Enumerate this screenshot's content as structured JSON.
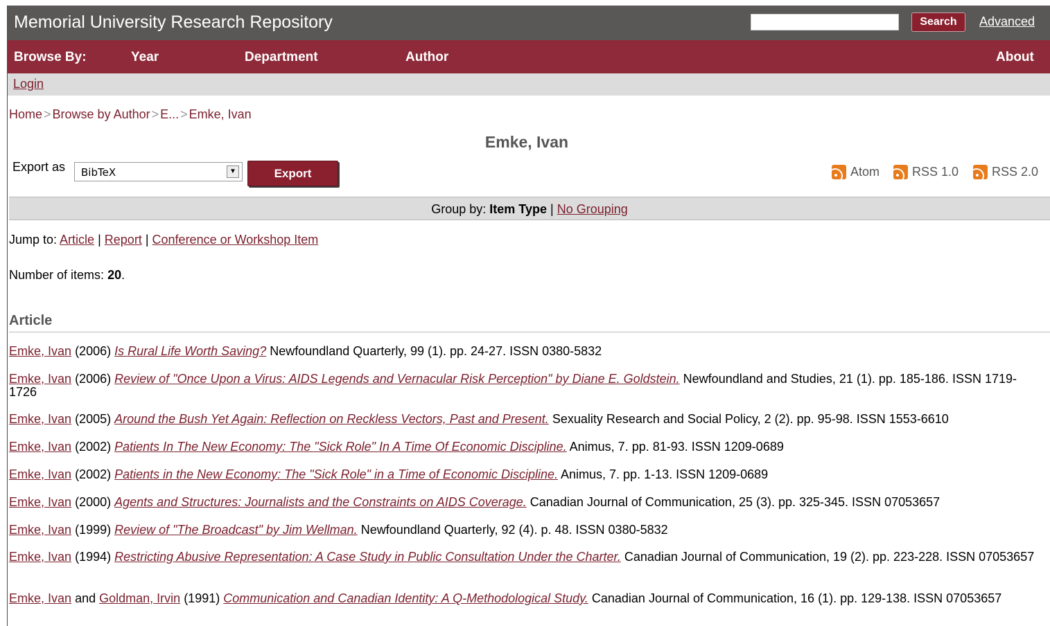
{
  "header": {
    "site_title": "Memorial University Research Repository",
    "search_value": "",
    "search_button": "Search",
    "advanced_link": "Advanced"
  },
  "nav": {
    "browse_by": "Browse By:",
    "year": "Year",
    "department": "Department",
    "author": "Author",
    "about": "About"
  },
  "login": "Login",
  "breadcrumb": [
    "Home",
    "Browse by Author",
    "E...",
    "Emke, Ivan"
  ],
  "breadcrumb_sep": ">",
  "page_title": "Emke, Ivan",
  "export": {
    "label": "Export as",
    "selected": "BibTeX",
    "button": "Export"
  },
  "feeds": [
    "Atom",
    "RSS 1.0",
    "RSS 2.0"
  ],
  "group_by": {
    "label": "Group by:",
    "current": "Item Type",
    "sep": "|",
    "alternative": "No Grouping"
  },
  "jump_to": {
    "label": "Jump to:",
    "links": [
      "Article",
      "Report",
      "Conference or Workshop Item"
    ],
    "sep": "|"
  },
  "item_count": {
    "label": "Number of items:",
    "value": "20",
    "suffix": "."
  },
  "section": "Article",
  "entries": [
    {
      "authors": [
        "Emke, Ivan"
      ],
      "year": "(2006)",
      "title": "Is Rural Life Worth Saving?",
      "rest": "Newfoundland Quarterly, 99 (1). pp. 24-27. ISSN 0380-5832"
    },
    {
      "authors": [
        "Emke, Ivan"
      ],
      "year": "(2006)",
      "title": "Review of \"Once Upon a Virus: AIDS Legends and Vernacular Risk Perception\" by Diane E. Goldstein.",
      "rest": "Newfoundland and Studies, 21 (1). pp. 185-186. ISSN 1719-1726"
    },
    {
      "authors": [
        "Emke, Ivan"
      ],
      "year": "(2005)",
      "title": "Around the Bush Yet Again: Reflection on Reckless Vectors, Past and Present.",
      "rest": "Sexuality Research and Social Policy, 2 (2). pp. 95-98. ISSN 1553-6610"
    },
    {
      "authors": [
        "Emke, Ivan"
      ],
      "year": "(2002)",
      "title": "Patients In The New Economy: The \"Sick Role\" In A Time Of Economic Discipline.",
      "rest": "Animus, 7. pp. 81-93. ISSN 1209-0689"
    },
    {
      "authors": [
        "Emke, Ivan"
      ],
      "year": "(2002)",
      "title": "Patients in the New Economy: The \"Sick Role\" in a Time of Economic Discipline.",
      "rest": "Animus, 7. pp. 1-13. ISSN 1209-0689"
    },
    {
      "authors": [
        "Emke, Ivan"
      ],
      "year": "(2000)",
      "title": "Agents and Structures: Journalists and the Constraints on AIDS Coverage.",
      "rest": "Canadian Journal of Communication, 25 (3). pp. 325-345. ISSN 07053657"
    },
    {
      "authors": [
        "Emke, Ivan"
      ],
      "year": "(1999)",
      "title": "Review of \"The Broadcast\" by Jim Wellman.",
      "rest": "Newfoundland Quarterly, 92 (4). p. 48. ISSN 0380-5832"
    },
    {
      "authors": [
        "Emke, Ivan"
      ],
      "year": "(1994)",
      "title": "Restricting Abusive Representation: A Case Study in Public Consultation Under the Charter.",
      "rest": "Canadian Journal of Communication, 19 (2). pp. 223-228. ISSN 07053657"
    },
    {
      "authors": [
        "Emke, Ivan",
        "Goldman, Irvin"
      ],
      "author_joiner": "and",
      "year": "(1991)",
      "title": "Communication and Canadian Identity: A Q-Methodological Study.",
      "rest": "Canadian Journal of Communication, 16 (1). pp. 129-138. ISSN 07053657"
    }
  ],
  "colors": {
    "header_bg": "#5a5757",
    "nav_bg": "#8e2a39",
    "link": "#7a1f2c",
    "bar_bg": "#dcdcdc",
    "feed_orange": "#e87b1c"
  }
}
